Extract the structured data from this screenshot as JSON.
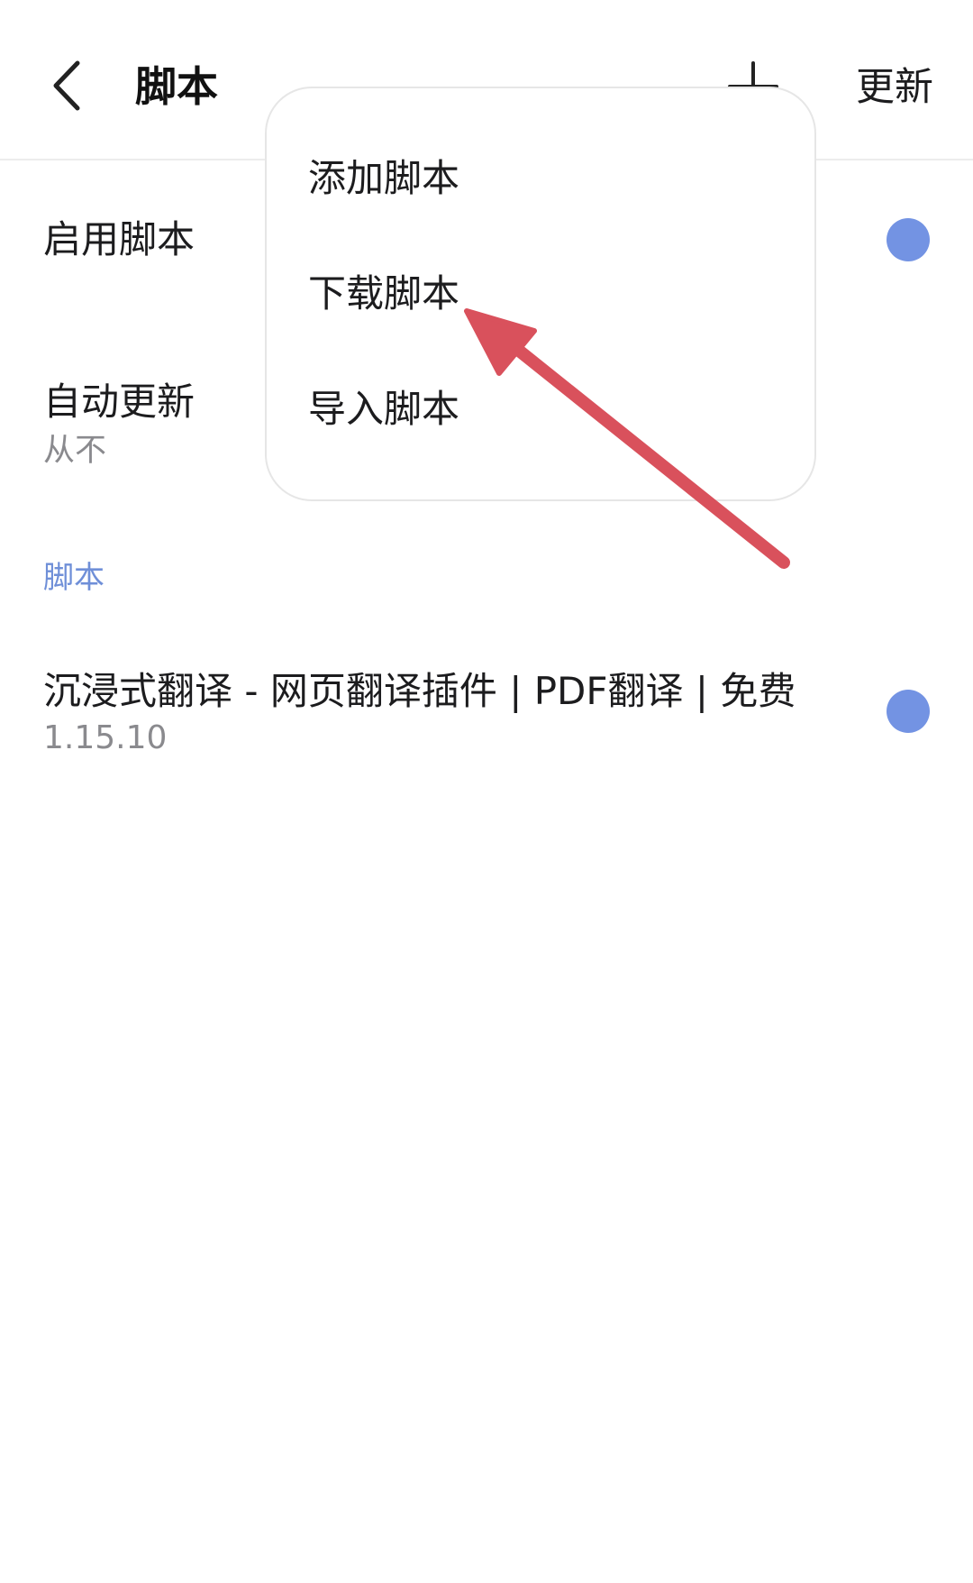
{
  "header": {
    "title": "脚本",
    "update_label": "更新"
  },
  "settings": {
    "enable_scripts": {
      "label": "启用脚本"
    },
    "auto_update": {
      "label": "自动更新",
      "value": "从不"
    }
  },
  "section": {
    "label": "脚本"
  },
  "scripts": [
    {
      "name": "沉浸式翻译 - 网页翻译插件 | PDF翻译 | 免费",
      "version": "1.15.10"
    }
  ],
  "menu": {
    "items": [
      {
        "label": "添加脚本"
      },
      {
        "label": "下载脚本"
      },
      {
        "label": "导入脚本"
      }
    ]
  },
  "colors": {
    "accent": "#6f8fd8",
    "toggle": "#7393e3",
    "annotation": "#d9515c"
  }
}
